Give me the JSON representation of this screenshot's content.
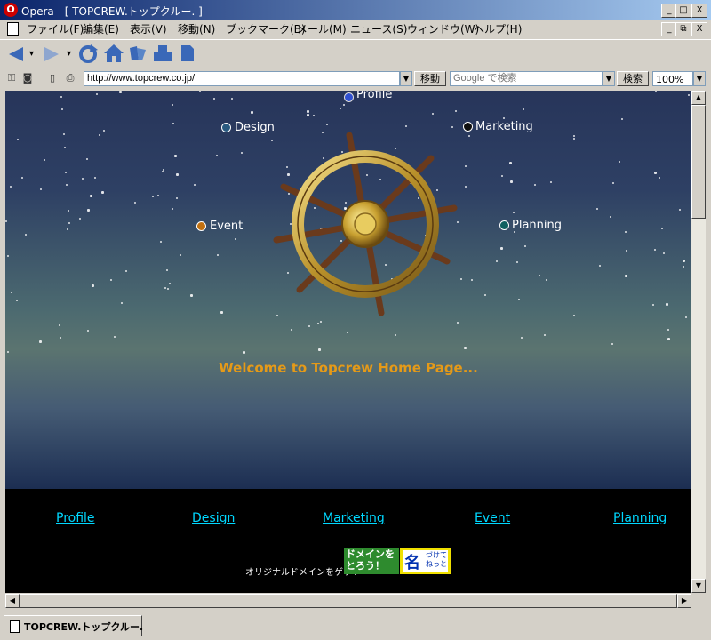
{
  "window": {
    "title": "Opera - [ TOPCREW.トップクルー. ]",
    "logo": "O",
    "minimize": "_",
    "restore": "□",
    "close": "X",
    "mdi_minimize": "_",
    "mdi_restore": "⧉",
    "mdi_close": "X"
  },
  "menu": {
    "items": [
      "ファイル(F)",
      "編集(E)",
      "表示(V)",
      "移動(N)",
      "ブックマーク(B)",
      "メール(M)",
      "ニュース(S)",
      "ウィンドウ(W)",
      "ヘルプ(H)"
    ]
  },
  "toolbar": {
    "icons": [
      "back-icon",
      "forward-icon",
      "reload-icon",
      "home-icon",
      "hotlist-icon",
      "print-icon",
      "page-icon"
    ]
  },
  "address": {
    "url": "http://www.topcrew.co.jp/",
    "go_label": "移動",
    "search_placeholder": "Google で検索",
    "search_label": "検索",
    "zoom": "100%"
  },
  "page": {
    "nav_wheel": [
      {
        "label": "Profile",
        "dot_color": "#3050d0"
      },
      {
        "label": "Design",
        "dot_color": "#2a5a80"
      },
      {
        "label": "Marketing",
        "dot_color": "#101010"
      },
      {
        "label": "Event",
        "dot_color": "#c07010"
      },
      {
        "label": "Planning",
        "dot_color": "#106060"
      }
    ],
    "welcome": "Welcome to Topcrew Home Page...",
    "footer_links": [
      "Profile",
      "Design",
      "Marketing",
      "Event",
      "Planning"
    ],
    "domain_text": "オリジナルドメインをゲット",
    "banner_green": "ドメインを とろう！",
    "banner_yellow_big": "名",
    "banner_yellow_small": "づけて ねっと"
  },
  "status": {
    "tab_label": "TOPCREW.トップクルー."
  },
  "colors": {
    "accent_link": "#00d8ff",
    "welcome": "#e59a18"
  }
}
